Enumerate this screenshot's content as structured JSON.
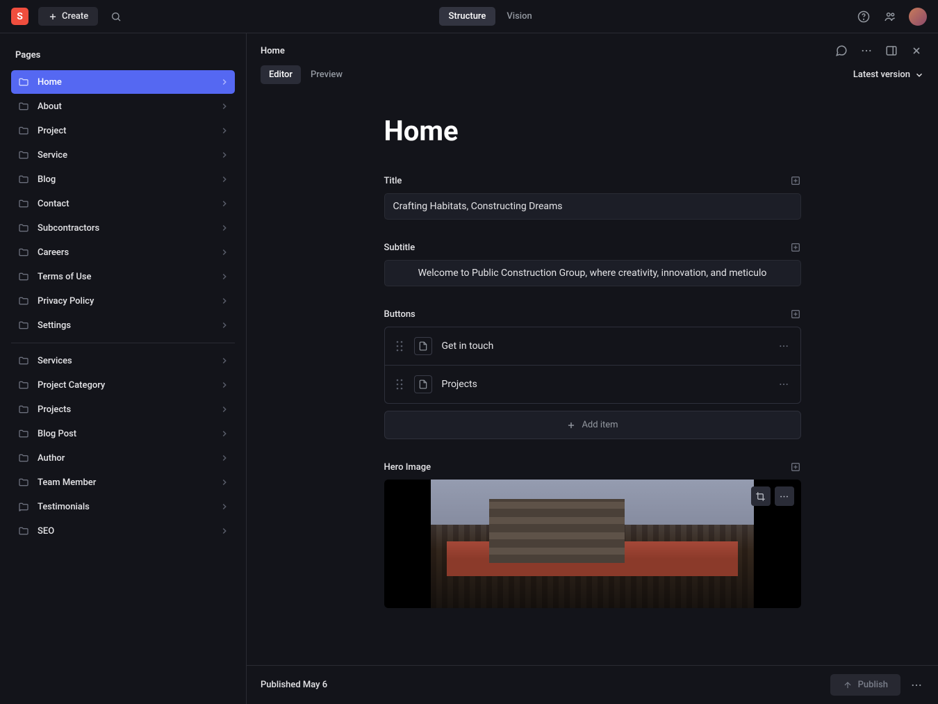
{
  "topbar": {
    "logo_letter": "S",
    "create_label": "Create",
    "tabs": [
      {
        "label": "Structure",
        "active": true
      },
      {
        "label": "Vision",
        "active": false
      }
    ]
  },
  "sidebar": {
    "title": "Pages",
    "group1": [
      {
        "label": "Home",
        "active": true
      },
      {
        "label": "About"
      },
      {
        "label": "Project"
      },
      {
        "label": "Service"
      },
      {
        "label": "Blog"
      },
      {
        "label": "Contact"
      },
      {
        "label": "Subcontractors"
      },
      {
        "label": "Careers"
      },
      {
        "label": "Terms of Use"
      },
      {
        "label": "Privacy Policy"
      },
      {
        "label": "Settings"
      }
    ],
    "group2": [
      {
        "label": "Services"
      },
      {
        "label": "Project Category"
      },
      {
        "label": "Projects"
      },
      {
        "label": "Blog Post"
      },
      {
        "label": "Author"
      },
      {
        "label": "Team Member"
      },
      {
        "label": "Testimonials"
      },
      {
        "label": "SEO"
      }
    ]
  },
  "content": {
    "breadcrumb": "Home",
    "mode_tabs": [
      {
        "label": "Editor",
        "active": true
      },
      {
        "label": "Preview",
        "active": false
      }
    ],
    "version_label": "Latest version",
    "page_title": "Home",
    "fields": {
      "title": {
        "label": "Title",
        "value": "Crafting Habitats, Constructing Dreams"
      },
      "subtitle": {
        "label": "Subtitle",
        "value": "Welcome to Public Construction Group, where creativity, innovation, and meticulo"
      },
      "buttons": {
        "label": "Buttons",
        "items": [
          {
            "label": "Get in touch"
          },
          {
            "label": "Projects"
          }
        ],
        "add_label": "Add item"
      },
      "hero": {
        "label": "Hero Image"
      }
    }
  },
  "footer": {
    "status": "Published May 6",
    "publish_label": "Publish"
  }
}
